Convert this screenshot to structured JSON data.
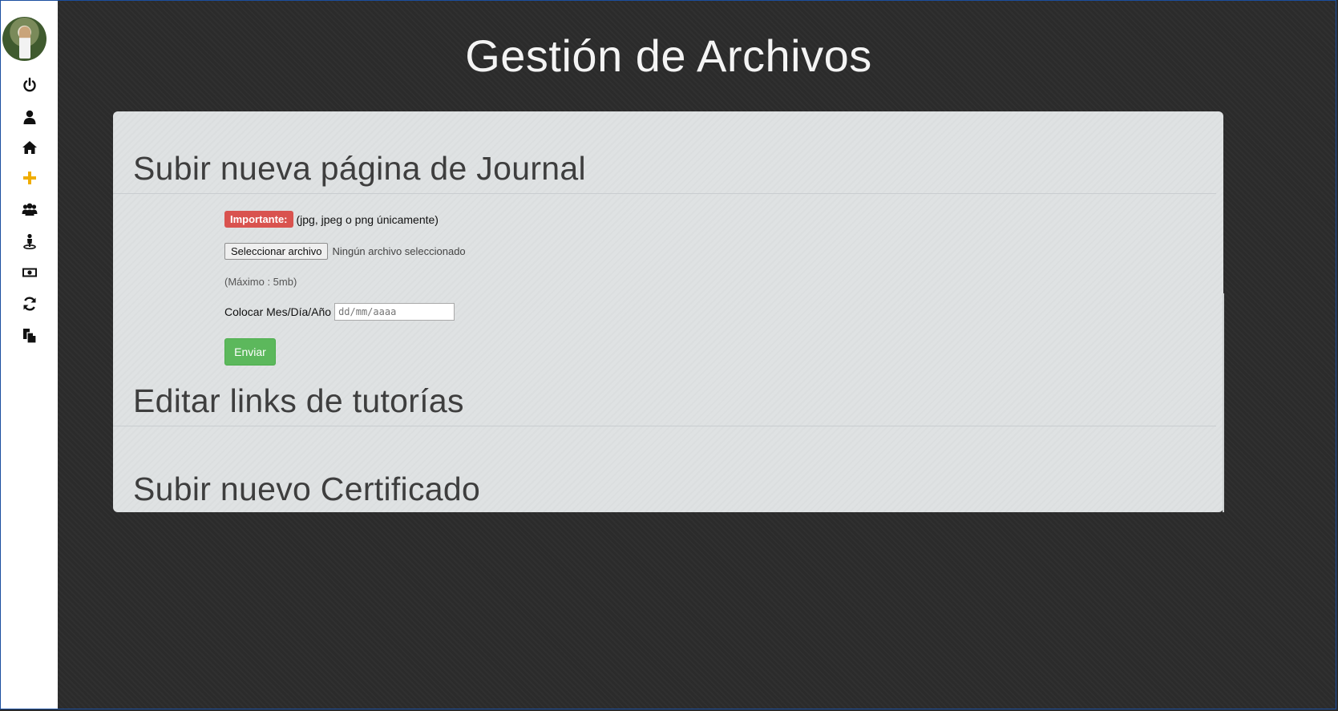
{
  "sidebar": {
    "items": [
      {
        "icon": "power-icon",
        "color": "#111111"
      },
      {
        "icon": "user-icon",
        "color": "#111111"
      },
      {
        "icon": "home-icon",
        "color": "#111111"
      },
      {
        "icon": "plus-icon",
        "color": "#f0ad00"
      },
      {
        "icon": "users-icon",
        "color": "#111111"
      },
      {
        "icon": "map-pin-person-icon",
        "color": "#111111"
      },
      {
        "icon": "money-icon",
        "color": "#111111"
      },
      {
        "icon": "refresh-icon",
        "color": "#111111"
      },
      {
        "icon": "files-icon",
        "color": "#111111"
      }
    ]
  },
  "page": {
    "title": "Gestión de Archivos"
  },
  "upload_journal": {
    "title": "Subir nueva página de Journal",
    "important_label": "Importante:",
    "important_text": "(jpg, jpeg o png únicamente)",
    "file_button": "Seleccionar archivo",
    "file_status": "Ningún archivo seleccionado",
    "max_size": "(Máximo : 5mb)",
    "date_label": "Colocar Mes/Día/Año",
    "date_placeholder": "dd/mm/aaaa",
    "submit": "Enviar"
  },
  "tutorials": {
    "title": "Editar links de tutorías"
  },
  "certificate": {
    "title": "Subir nuevo Certificado"
  },
  "colors": {
    "background": "#2b2b2b",
    "panel": "#dfe2e3",
    "important": "#d9534f",
    "submit": "#5cb85c",
    "accent_plus": "#f0ad00"
  }
}
